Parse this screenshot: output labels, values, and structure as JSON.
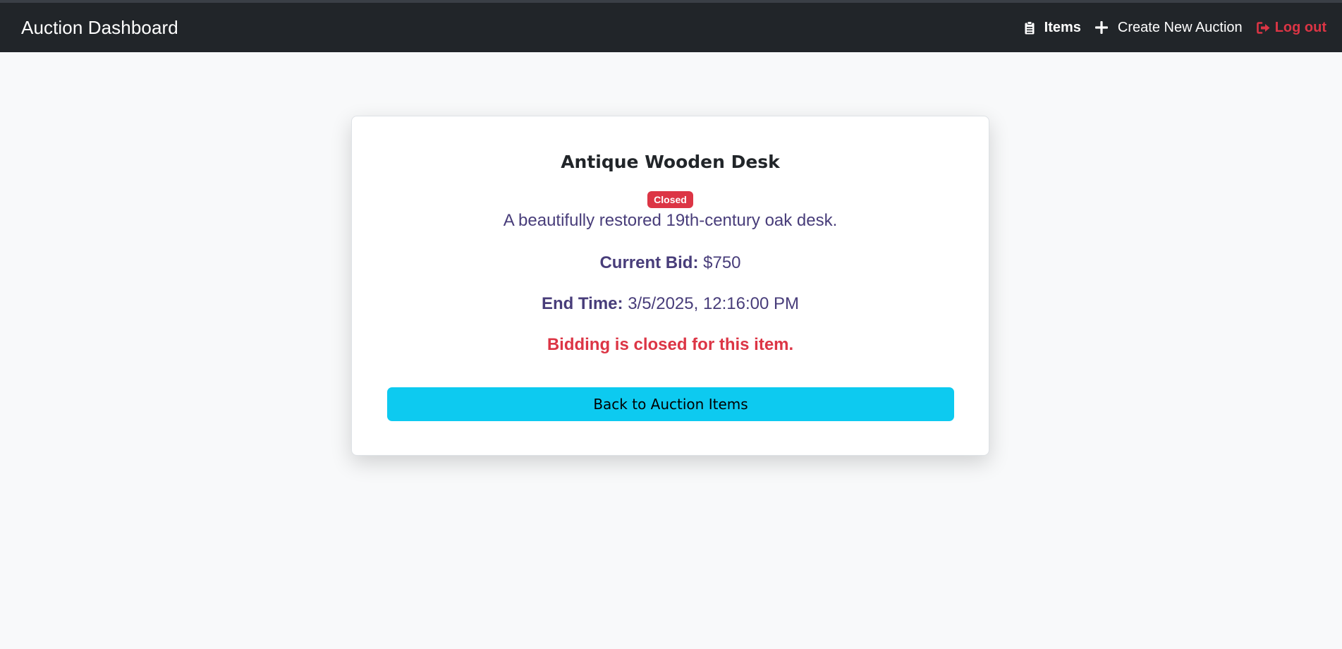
{
  "navbar": {
    "brand": "Auction Dashboard",
    "links": [
      {
        "label": "Items",
        "icon": "clipboard-list-icon"
      },
      {
        "label": "Create New Auction",
        "icon": "plus-icon"
      },
      {
        "label": "Log out",
        "icon": "sign-out-icon"
      }
    ]
  },
  "item": {
    "title": "Antique Wooden Desk",
    "status": "Closed",
    "description": "A beautifully restored 19th-century oak desk.",
    "current_bid_label": "Current Bid:",
    "current_bid_value": "$750",
    "end_time_label": "End Time:",
    "end_time_value": "3/5/2025, 12:16:00 PM",
    "closed_message": "Bidding is closed for this item."
  },
  "actions": {
    "back_label": "Back to Auction Items"
  },
  "colors": {
    "navbar_bg": "#212529",
    "page_bg": "#f8f9fa",
    "danger": "#dc3545",
    "info_button": "#0dcaf0",
    "text_accent": "#483d7a"
  }
}
